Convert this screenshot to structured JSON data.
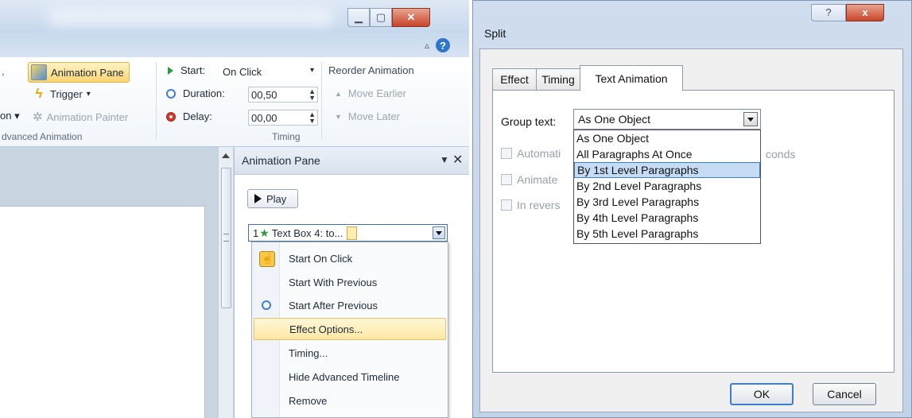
{
  "left_window": {
    "ribbon": {
      "animation_pane_btn": "Animation Pane",
      "trigger_btn": "Trigger",
      "trigger_caret": "▾",
      "animation_painter_partial": "on ▾",
      "animation_painter": "Animation Painter",
      "advanced_group_label": "dvanced Animation",
      "start_label": "Start:",
      "start_value": "On Click",
      "duration_label": "Duration:",
      "duration_value": "00,50",
      "delay_label": "Delay:",
      "delay_value": "00,00",
      "timing_group_label": "Timing",
      "reorder_title": "Reorder Animation",
      "move_earlier": "Move Earlier",
      "move_later": "Move Later"
    },
    "pane": {
      "title": "Animation Pane",
      "play_label": "Play",
      "item_number": "1",
      "item_label": "Text Box 4: to...",
      "menu": [
        {
          "label": "Start On Click",
          "icon": "mouse-click-icon"
        },
        {
          "label": "Start With Previous",
          "icon": ""
        },
        {
          "label": "Start After Previous",
          "icon": "clock-icon"
        },
        {
          "label": "Effect Options...",
          "icon": ""
        },
        {
          "label": "Timing...",
          "icon": ""
        },
        {
          "label": "Hide Advanced Timeline",
          "icon": ""
        },
        {
          "label": "Remove",
          "icon": ""
        }
      ]
    }
  },
  "dialog": {
    "title": "Split",
    "help_glyph": "?",
    "close_glyph": "x",
    "tabs": [
      "Effect",
      "Timing",
      "Text Animation"
    ],
    "active_tab": "Text Animation",
    "group_text_label": "Group text:",
    "group_text_value": "As One Object",
    "automatic_partial": "Automati",
    "seconds_partial": "conds",
    "animate_partial": "Animate",
    "reverse_partial": "In revers",
    "dropdown_options": [
      "As One Object",
      "All Paragraphs At Once",
      "By 1st Level Paragraphs",
      "By 2nd Level Paragraphs",
      "By 3rd Level Paragraphs",
      "By 4th Level Paragraphs",
      "By 5th Level Paragraphs"
    ],
    "highlighted_option": "By 1st Level Paragraphs",
    "ok_label": "OK",
    "cancel_label": "Cancel"
  },
  "colors": {
    "selection_blue": "#3c7fd1",
    "menu_highlight": "#fde7a4",
    "close_red": "#c8452a"
  }
}
